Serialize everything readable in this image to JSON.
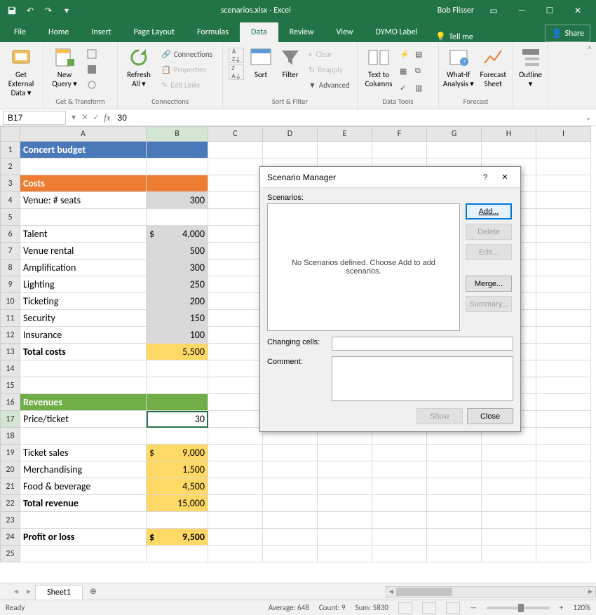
{
  "titlebar": {
    "title": "scenarios.xlsx - Excel",
    "user": "Bob Flisser"
  },
  "tabs": [
    "File",
    "Home",
    "Insert",
    "Page Layout",
    "Formulas",
    "Data",
    "Review",
    "View",
    "DYMO Label"
  ],
  "active_tab": "Data",
  "tell_me": "Tell me",
  "share": "Share",
  "ribbon": {
    "groups": {
      "transform": {
        "get_external": "Get External\nData ▾",
        "new_query": "New\nQuery ▾",
        "refresh_all": "Refresh\nAll ▾",
        "label": "Get & Transform"
      },
      "connections": {
        "connections": "Connections",
        "properties": "Properties",
        "edit_links": "Edit Links",
        "label": "Connections"
      },
      "sortfilter": {
        "az": "A↓Z",
        "za": "Z↓A",
        "sort": "Sort",
        "filter": "Filter",
        "clear": "Clear",
        "reapply": "Reapply",
        "advanced": "Advanced",
        "label": "Sort & Filter"
      },
      "datatools": {
        "t2c": "Text to\nColumns",
        "label": "Data Tools"
      },
      "forecast": {
        "whatif": "What-If\nAnalysis ▾",
        "fsheet": "Forecast\nSheet",
        "label": "Forecast"
      },
      "outline": {
        "outline": "Outline\n▾"
      }
    }
  },
  "namebox": "B17",
  "formula": "30",
  "cols": [
    "A",
    "B",
    "C",
    "D",
    "E",
    "F",
    "G",
    "H",
    "I"
  ],
  "rows": {
    "1": {
      "A": "Concert budget",
      "cls_A": "hdr-blue",
      "cls_B": "hdr-blue"
    },
    "2": {},
    "3": {
      "A": "Costs",
      "cls_A": "hdr-orange",
      "cls_B": "hdr-orange"
    },
    "4": {
      "A": "Venue: # seats",
      "B": "300",
      "cls_B": "shade-grey txt-right"
    },
    "5": {},
    "6": {
      "A": "Talent",
      "B": {
        "cur": "$",
        "val": "4,000"
      },
      "cls_B": "shade-grey"
    },
    "7": {
      "A": "Venue rental",
      "B": "500",
      "cls_B": "shade-grey txt-right"
    },
    "8": {
      "A": "Amplification",
      "B": "300",
      "cls_B": "shade-grey txt-right"
    },
    "9": {
      "A": "Lighting",
      "B": "250",
      "cls_B": "shade-grey txt-right"
    },
    "10": {
      "A": "Ticketing",
      "B": "200",
      "cls_B": "shade-grey txt-right"
    },
    "11": {
      "A": "Security",
      "B": "150",
      "cls_B": "shade-grey txt-right"
    },
    "12": {
      "A": "Insurance",
      "B": "100",
      "cls_B": "shade-grey txt-right"
    },
    "13": {
      "A": "Total costs",
      "cls_A": "bold",
      "B": "5,500",
      "cls_B": "shade-yellow txt-right"
    },
    "14": {},
    "15": {},
    "16": {
      "A": "Revenues",
      "cls_A": "hdr-green",
      "cls_B": "hdr-green"
    },
    "17": {
      "A": "Price/ticket",
      "B": "30",
      "cls_B": "txt-right selected"
    },
    "18": {},
    "19": {
      "A": "Ticket sales",
      "B": {
        "cur": "$",
        "val": "9,000"
      },
      "cls_B": "shade-yellow"
    },
    "20": {
      "A": "Merchandising",
      "B": "1,500",
      "cls_B": "shade-yellow txt-right"
    },
    "21": {
      "A": "Food & beverage",
      "B": "4,500",
      "cls_B": "shade-yellow txt-right"
    },
    "22": {
      "A": "Total revenue",
      "cls_A": "bold",
      "B": "15,000",
      "cls_B": "shade-yellow txt-right"
    },
    "23": {},
    "24": {
      "A": "Profit or loss",
      "cls_A": "bold",
      "B": {
        "cur": "$",
        "val": "9,500"
      },
      "cls_B": "shade-yellow bold"
    },
    "25": {}
  },
  "sheet_tab": "Sheet1",
  "statusbar": {
    "ready": "Ready",
    "avg": "Average: 648",
    "count": "Count: 9",
    "sum": "Sum: 5830",
    "zoom": "120%"
  },
  "dialog": {
    "title": "Scenario Manager",
    "scenarios_label": "Scenarios:",
    "empty_msg": "No Scenarios defined. Choose Add to add scenarios.",
    "btn_add": "Add...",
    "btn_delete": "Delete",
    "btn_edit": "Edit...",
    "btn_merge": "Merge...",
    "btn_summary": "Summary...",
    "changing_cells": "Changing cells:",
    "comment": "Comment:",
    "btn_show": "Show",
    "btn_close": "Close"
  }
}
